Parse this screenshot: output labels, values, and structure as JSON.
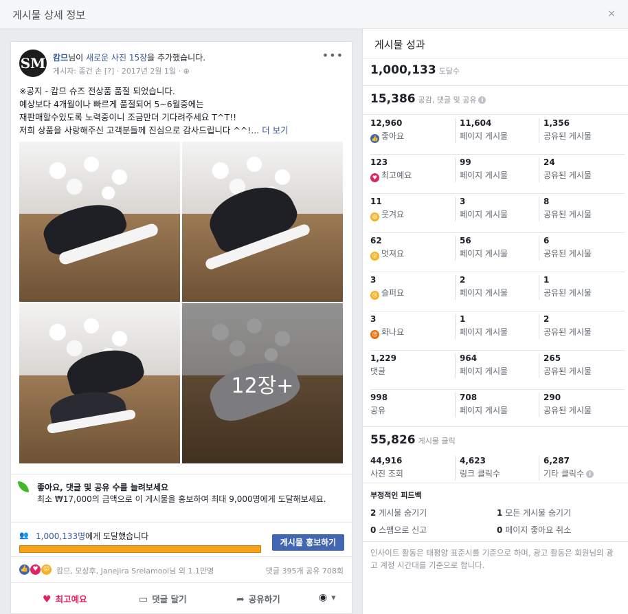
{
  "header": {
    "title": "게시물 상세 정보",
    "close_label": "×"
  },
  "post": {
    "avatar_text": "SM",
    "page_name": "캄므",
    "action_pre": "님이 ",
    "action_link": "새로운 사진 15장",
    "action_post": "을 추가했습니다.",
    "meta": "게시자: 종건 손 [?] · 2017년 2월 1일 · ",
    "more_menu": "•••",
    "text_lines": [
      "※공지 - 캄므 슈즈 전상품 품절 되었습니다.",
      "예상보다 4개월이나 빠르게 품절되어 5~6월중에는",
      "재판매할수있도록 노력중이니 조금만더 기다려주세요 T^T!!"
    ],
    "text_last": "저희 상품을 사랑해주신 고객분들께 진심으로 감사드립니다 ^^!... ",
    "see_more": "더 보기",
    "photo_more_overlay": "12장+",
    "boost_title": "좋아요, 댓글 및 공유 수를 늘려보세요",
    "boost_desc": "최소 ₩17,000의 금액으로 이 게시물을 홍보하여 최대 9,000명에게 도달해보세요.",
    "reach_count": "1,000,133명",
    "reach_suffix": "에게 도달했습니다",
    "reach_fill_fraction": 0.0,
    "boost_button": "게시물 홍보하기",
    "reaction_names": "캄므, 모상후, Janejira Srelamool님 외 1.1만명",
    "reaction_stats": "댓글 395개   공유 708회",
    "actions": {
      "love": "최고예요",
      "comment": "댓글 달기",
      "share": "공유하기"
    }
  },
  "performance": {
    "title": "게시물 성과",
    "reach": {
      "value": "1,000,133",
      "unit": "도달수"
    },
    "engagement": {
      "value": "15,386",
      "unit": "공감, 댓글 및 공유"
    },
    "rows": [
      {
        "emoji": "like",
        "color": "#4267b2",
        "total": "12,960",
        "label": "좋아요",
        "on_post": "11,604",
        "on_post_label": "페이지 게시물",
        "on_shares": "1,356",
        "on_shares_label": "공유된 게시물"
      },
      {
        "emoji": "love",
        "color": "#e0245e",
        "total": "123",
        "label": "최고예요",
        "on_post": "99",
        "on_post_label": "페이지 게시물",
        "on_shares": "24",
        "on_shares_label": "공유된 게시물"
      },
      {
        "emoji": "haha",
        "color": "#f7b125",
        "total": "11",
        "label": "웃겨요",
        "on_post": "3",
        "on_post_label": "페이지 게시물",
        "on_shares": "8",
        "on_shares_label": "공유된 게시물"
      },
      {
        "emoji": "wow",
        "color": "#f7b125",
        "total": "62",
        "label": "멋져요",
        "on_post": "56",
        "on_post_label": "페이지 게시물",
        "on_shares": "6",
        "on_shares_label": "공유된 게시물"
      },
      {
        "emoji": "sad",
        "color": "#f7b125",
        "total": "3",
        "label": "슬퍼요",
        "on_post": "2",
        "on_post_label": "페이지 게시물",
        "on_shares": "1",
        "on_shares_label": "공유된 게시물"
      },
      {
        "emoji": "angry",
        "color": "#e9710f",
        "total": "3",
        "label": "화나요",
        "on_post": "1",
        "on_post_label": "페이지 게시물",
        "on_shares": "2",
        "on_shares_label": "공유된 게시물"
      },
      {
        "emoji": "",
        "color": "",
        "total": "1,229",
        "label": "댓글",
        "on_post": "964",
        "on_post_label": "페이지 게시물",
        "on_shares": "265",
        "on_shares_label": "공유된 게시물"
      },
      {
        "emoji": "",
        "color": "",
        "total": "998",
        "label": "공유",
        "on_post": "708",
        "on_post_label": "페이지 게시물",
        "on_shares": "290",
        "on_shares_label": "공유된 게시물"
      }
    ],
    "clicks": {
      "value": "55,826",
      "unit": "게시물 클릭"
    },
    "click_breakdown": [
      {
        "value": "44,916",
        "label": "사진 조회"
      },
      {
        "value": "4,623",
        "label": "링크 클릭수"
      },
      {
        "value": "6,287",
        "label": "기타 클릭수"
      }
    ],
    "negative": {
      "title": "부정적인 피드백",
      "hide_post": {
        "value": "2",
        "label": "게시물 숨기기"
      },
      "hide_all": {
        "value": "1",
        "label": "모든 게시물 숨기기"
      },
      "spam": {
        "value": "0",
        "label": "스팸으로 신고"
      },
      "unlike": {
        "value": "0",
        "label": "페이지 좋아요 취소"
      }
    },
    "note": "인사이트 활동은 태평양 표준시를 기준으로 하며, 광고 활동은 회원님의 광고 계정 시간대를 기준으로 합니다."
  }
}
